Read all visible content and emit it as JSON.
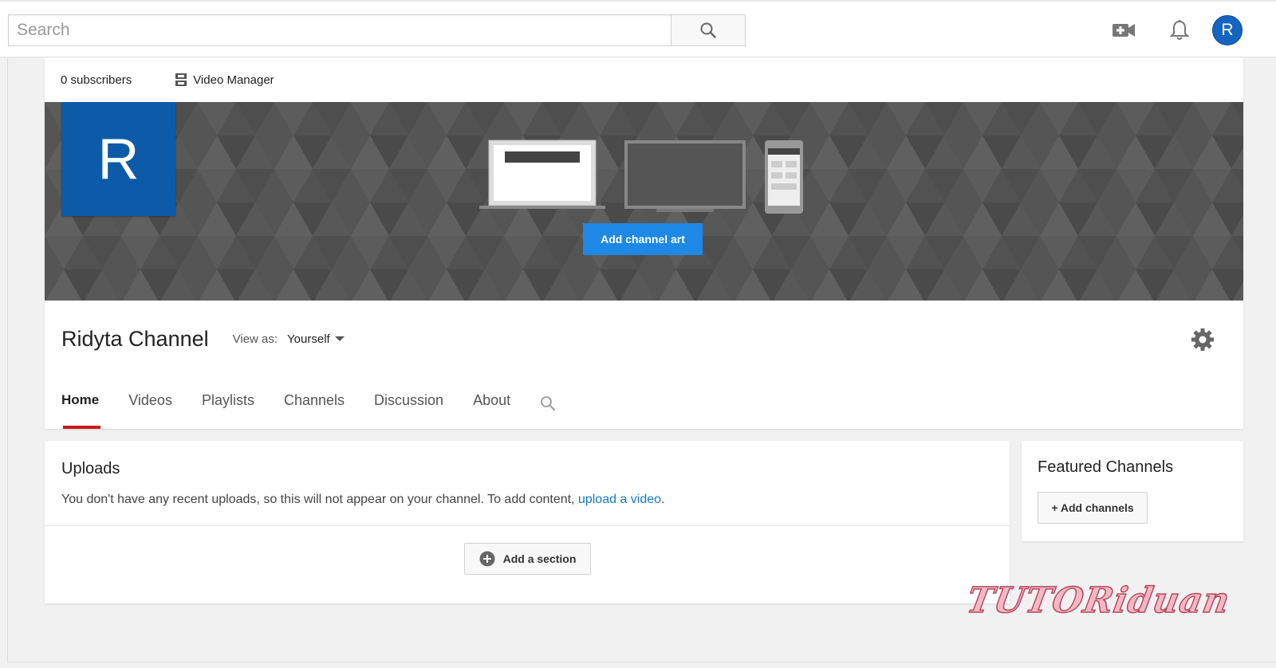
{
  "header": {
    "search_placeholder": "Search",
    "avatar_letter": "R",
    "icons": [
      "search-icon",
      "upload-video-icon",
      "notifications-bell-icon"
    ]
  },
  "channel": {
    "subscribers": "0 subscribers",
    "video_manager": "Video Manager",
    "logo_letter": "R",
    "add_channel_art": "Add channel art",
    "title": "Ridyta Channel",
    "view_as_label": "View as:",
    "view_as_value": "Yourself",
    "tabs": [
      "Home",
      "Videos",
      "Playlists",
      "Channels",
      "Discussion",
      "About"
    ],
    "active_tab": "Home"
  },
  "uploads": {
    "title": "Uploads",
    "text": "You don't have any recent uploads, so this will not appear on your channel. To add content, ",
    "link": "upload a video",
    "text_end": ".",
    "add_section": "Add a section"
  },
  "featured": {
    "title": "Featured Channels",
    "add_channels": "+ Add channels"
  },
  "watermark": "TUTORiduan",
  "colors": {
    "accent_blue": "#1e88e5",
    "logo_blue": "#0d5ba8",
    "link_blue": "#167ac6",
    "active_tab_red": "#cc181e",
    "banner_gray": "#555555"
  }
}
